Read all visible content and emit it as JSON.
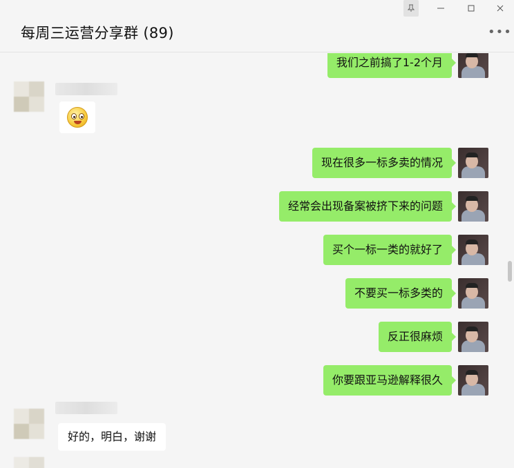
{
  "window": {
    "pin_icon": "pin-icon",
    "minimize_icon": "minimize-icon",
    "maximize_icon": "maximize-icon",
    "close_icon": "close-icon"
  },
  "header": {
    "title": "每周三运营分享群 (89)",
    "more_icon": "more-icon"
  },
  "messages": [
    {
      "side": "out",
      "text": "我们之前搞了1-2个月"
    },
    {
      "side": "in",
      "type": "emoji",
      "emoji": "flushed-face"
    },
    {
      "side": "out",
      "text": "现在很多一标多卖的情况"
    },
    {
      "side": "out",
      "text": "经常会出现备案被挤下来的问题"
    },
    {
      "side": "out",
      "text": "买个一标一类的就好了"
    },
    {
      "side": "out",
      "text": "不要买一标多类的"
    },
    {
      "side": "out",
      "text": "反正很麻烦"
    },
    {
      "side": "out",
      "text": "你要跟亚马逊解释很久"
    },
    {
      "side": "in",
      "text": "好的，明白，谢谢"
    }
  ],
  "colors": {
    "outgoing_bubble": "#95ec69",
    "incoming_bubble": "#ffffff",
    "background": "#f5f5f5"
  }
}
